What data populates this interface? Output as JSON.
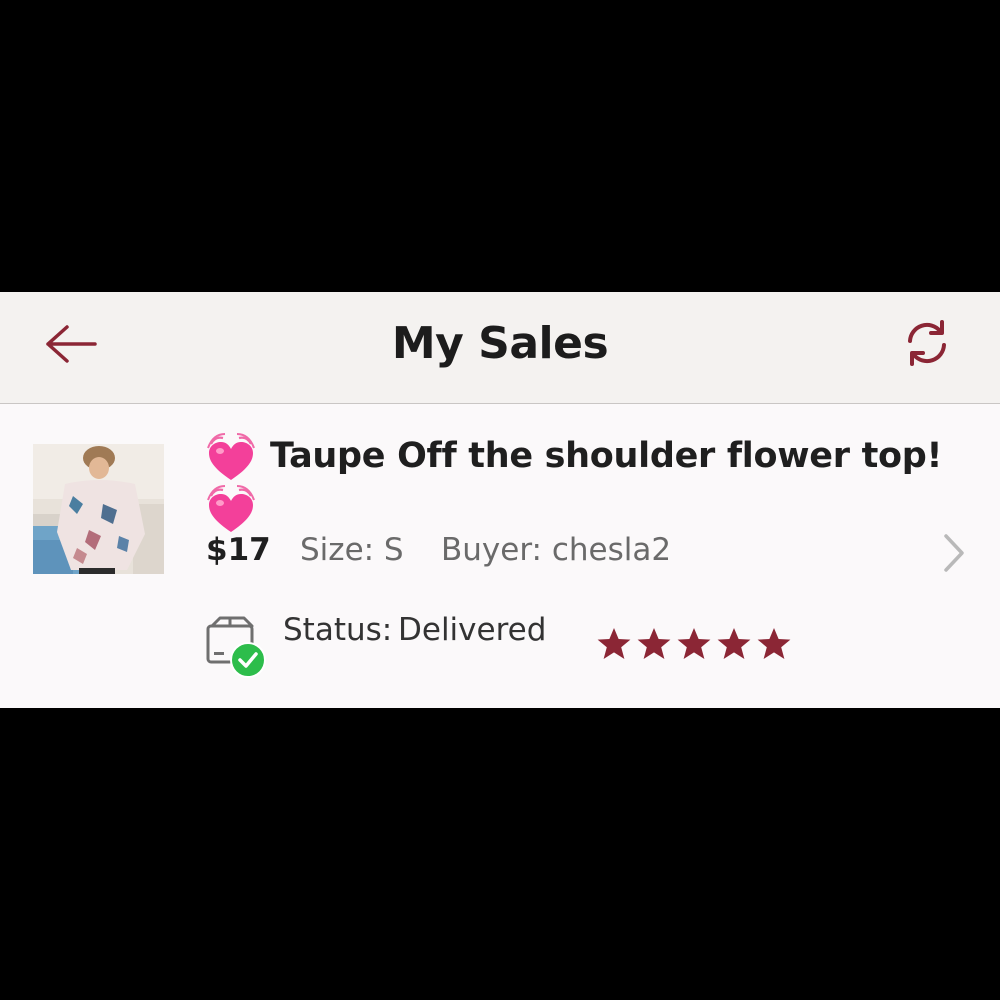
{
  "header": {
    "title": "My Sales",
    "back_icon": "arrow-left-icon",
    "refresh_icon": "refresh-icon",
    "accent_color": "#8b2635"
  },
  "sale": {
    "title": "Taupe Off the shoulder flower top!",
    "title_emoji": "growing-heart",
    "price": "$17",
    "size": "Size: S",
    "buyer": "Buyer: chesla2",
    "status_label": "Status:",
    "status_value": "Delivered",
    "status_icon": "delivered-box-check-icon",
    "rating": 5,
    "rating_max": 5,
    "star_color": "#8b2635",
    "chevron_icon": "chevron-right-icon"
  }
}
